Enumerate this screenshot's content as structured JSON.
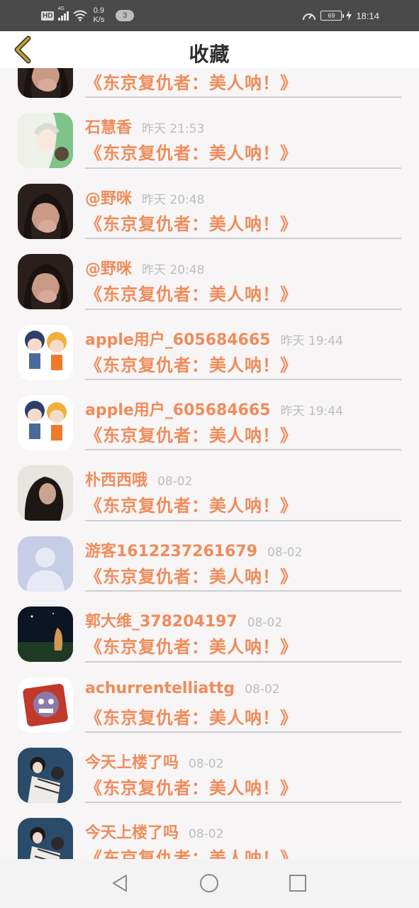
{
  "status_bar": {
    "network_badge": "HD",
    "signal_label": "4G",
    "speed_value": "0.9",
    "speed_unit": "K/s",
    "notification_count": "3",
    "battery": "69",
    "time": "18:14"
  },
  "header": {
    "title": "收藏",
    "back_icon": "chevron-left-icon"
  },
  "items": [
    {
      "name": "",
      "time": "",
      "content": "《东京复仇者：美人呐！》",
      "avatar": "dark-portrait"
    },
    {
      "name": "石慧香",
      "time": "昨天 21:53",
      "content": "《东京复仇者：美人呐！》",
      "avatar": "anime-white-hair"
    },
    {
      "name": "@野咪",
      "time": "昨天 20:48",
      "content": "《东京复仇者：美人呐！》",
      "avatar": "dark-portrait"
    },
    {
      "name": "@野咪",
      "time": "昨天 20:48",
      "content": "《东京复仇者：美人呐！》",
      "avatar": "dark-portrait"
    },
    {
      "name": "apple用户_605684665",
      "time": "昨天 19:44",
      "content": "《东京复仇者：美人呐！》",
      "avatar": "anime-chibi-pair"
    },
    {
      "name": "apple用户_605684665",
      "time": "昨天 19:44",
      "content": "《东京复仇者：美人呐！》",
      "avatar": "anime-chibi-pair"
    },
    {
      "name": "朴西西哦",
      "time": "08-02",
      "content": "《东京复仇者：美人呐！》",
      "avatar": "woman-portrait"
    },
    {
      "name": "游客1612237261679",
      "time": "08-02",
      "content": "《东京复仇者：美人呐！》",
      "avatar": "default-user"
    },
    {
      "name": "郭大维_378204197",
      "time": "08-02",
      "content": "《东京复仇者：美人呐！》",
      "avatar": "night-scene"
    },
    {
      "name": "achurrentelliattg",
      "time": "08-02",
      "content": "《东京复仇者：美人呐！》",
      "avatar": "cartoon-monster"
    },
    {
      "name": "今天上楼了吗",
      "time": "08-02",
      "content": "《东京复仇者：美人呐！》",
      "avatar": "couple-photo"
    },
    {
      "name": "今天上楼了吗",
      "time": "08-02",
      "content": "《东京复仇者：美人呐！》",
      "avatar": "couple-photo"
    }
  ],
  "nav_bar": {
    "back": "triangle-back-icon",
    "home": "circle-home-icon",
    "recent": "square-recent-icon"
  },
  "colors": {
    "accent": "#ef8c5a",
    "muted": "#bdbdbd",
    "status_bar": "#4a4a4a",
    "back_chevron": "#c9a227"
  }
}
